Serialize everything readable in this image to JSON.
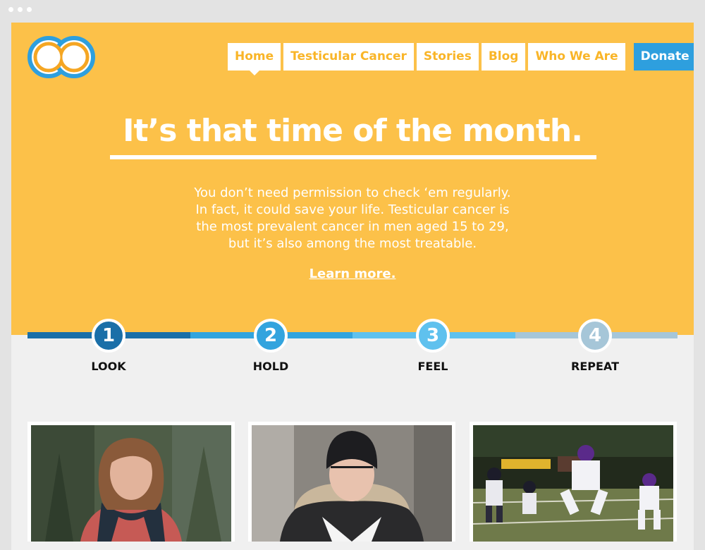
{
  "nav": {
    "items": [
      "Home",
      "Testicular Cancer",
      "Stories",
      "Blog",
      "Who We Are"
    ],
    "donate": "Donate"
  },
  "hero": {
    "headline": "It’s that time of the month.",
    "intro": "You don’t need permission to check ‘em regularly. In fact, it could save your life. Testicular cancer is the most prevalent cancer in men aged 15 to 29, but it’s also among the most treatable.",
    "learn_more": "Learn more."
  },
  "steps": [
    {
      "number": "1",
      "label": "LOOK"
    },
    {
      "number": "2",
      "label": "HOLD"
    },
    {
      "number": "3",
      "label": "FEEL"
    },
    {
      "number": "4",
      "label": "REPEAT"
    }
  ],
  "colors": {
    "hero_bg": "#fcc149",
    "nav_text": "#f9b528",
    "donate_bg": "#2e9fde",
    "step_1": "#1a6fa8",
    "step_2": "#33a4de",
    "step_3": "#5fc1ee",
    "step_4": "#a6c6d8"
  }
}
